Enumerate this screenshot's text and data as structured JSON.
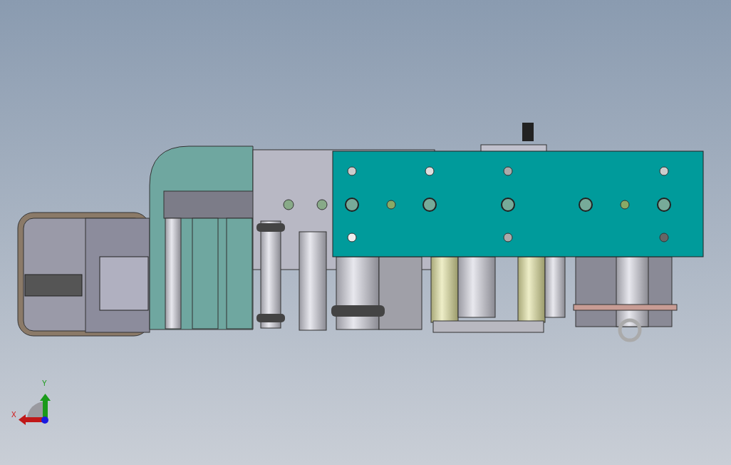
{
  "viewport": {
    "kind": "cad-model"
  },
  "triad": {
    "x_label": "X",
    "y_label": "Y"
  }
}
